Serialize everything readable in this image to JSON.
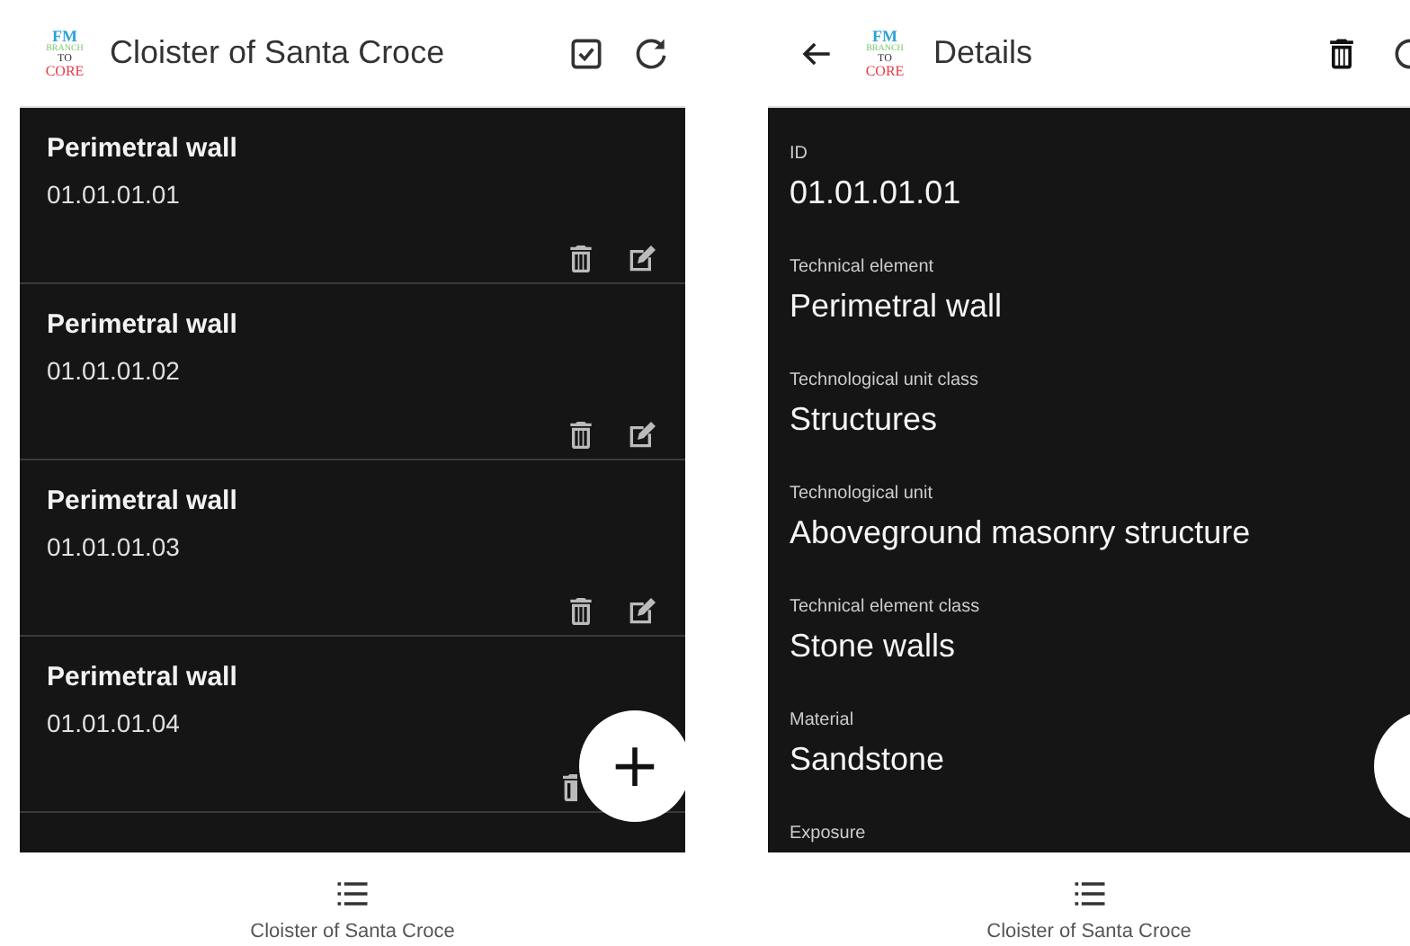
{
  "list_screen": {
    "logo": [
      "FM",
      "BRANCH",
      "TO",
      "CORE"
    ],
    "title": "Cloister of Santa Croce",
    "items": [
      {
        "title": "Perimetral wall",
        "code": "01.01.01.01"
      },
      {
        "title": "Perimetral wall",
        "code": "01.01.01.02"
      },
      {
        "title": "Perimetral wall",
        "code": "01.01.01.03"
      },
      {
        "title": "Perimetral wall",
        "code": "01.01.01.04"
      }
    ],
    "fab": "+",
    "bottom_nav": {
      "label": "Cloister of Santa Croce"
    }
  },
  "details_screen": {
    "logo": [
      "FM",
      "BRANCH",
      "TO",
      "CORE"
    ],
    "title": "Details",
    "fields": [
      {
        "label": "ID",
        "value": "01.01.01.01"
      },
      {
        "label": "Technical element",
        "value": "Perimetral wall"
      },
      {
        "label": "Technological unit class",
        "value": "Structures"
      },
      {
        "label": "Technological unit",
        "value": "Aboveground masonry structure"
      },
      {
        "label": "Technical element class",
        "value": "Stone walls"
      },
      {
        "label": "Material",
        "value": "Sandstone"
      },
      {
        "label": "Exposure"
      }
    ],
    "bottom_nav": {
      "label": "Cloister of Santa Croce"
    }
  }
}
